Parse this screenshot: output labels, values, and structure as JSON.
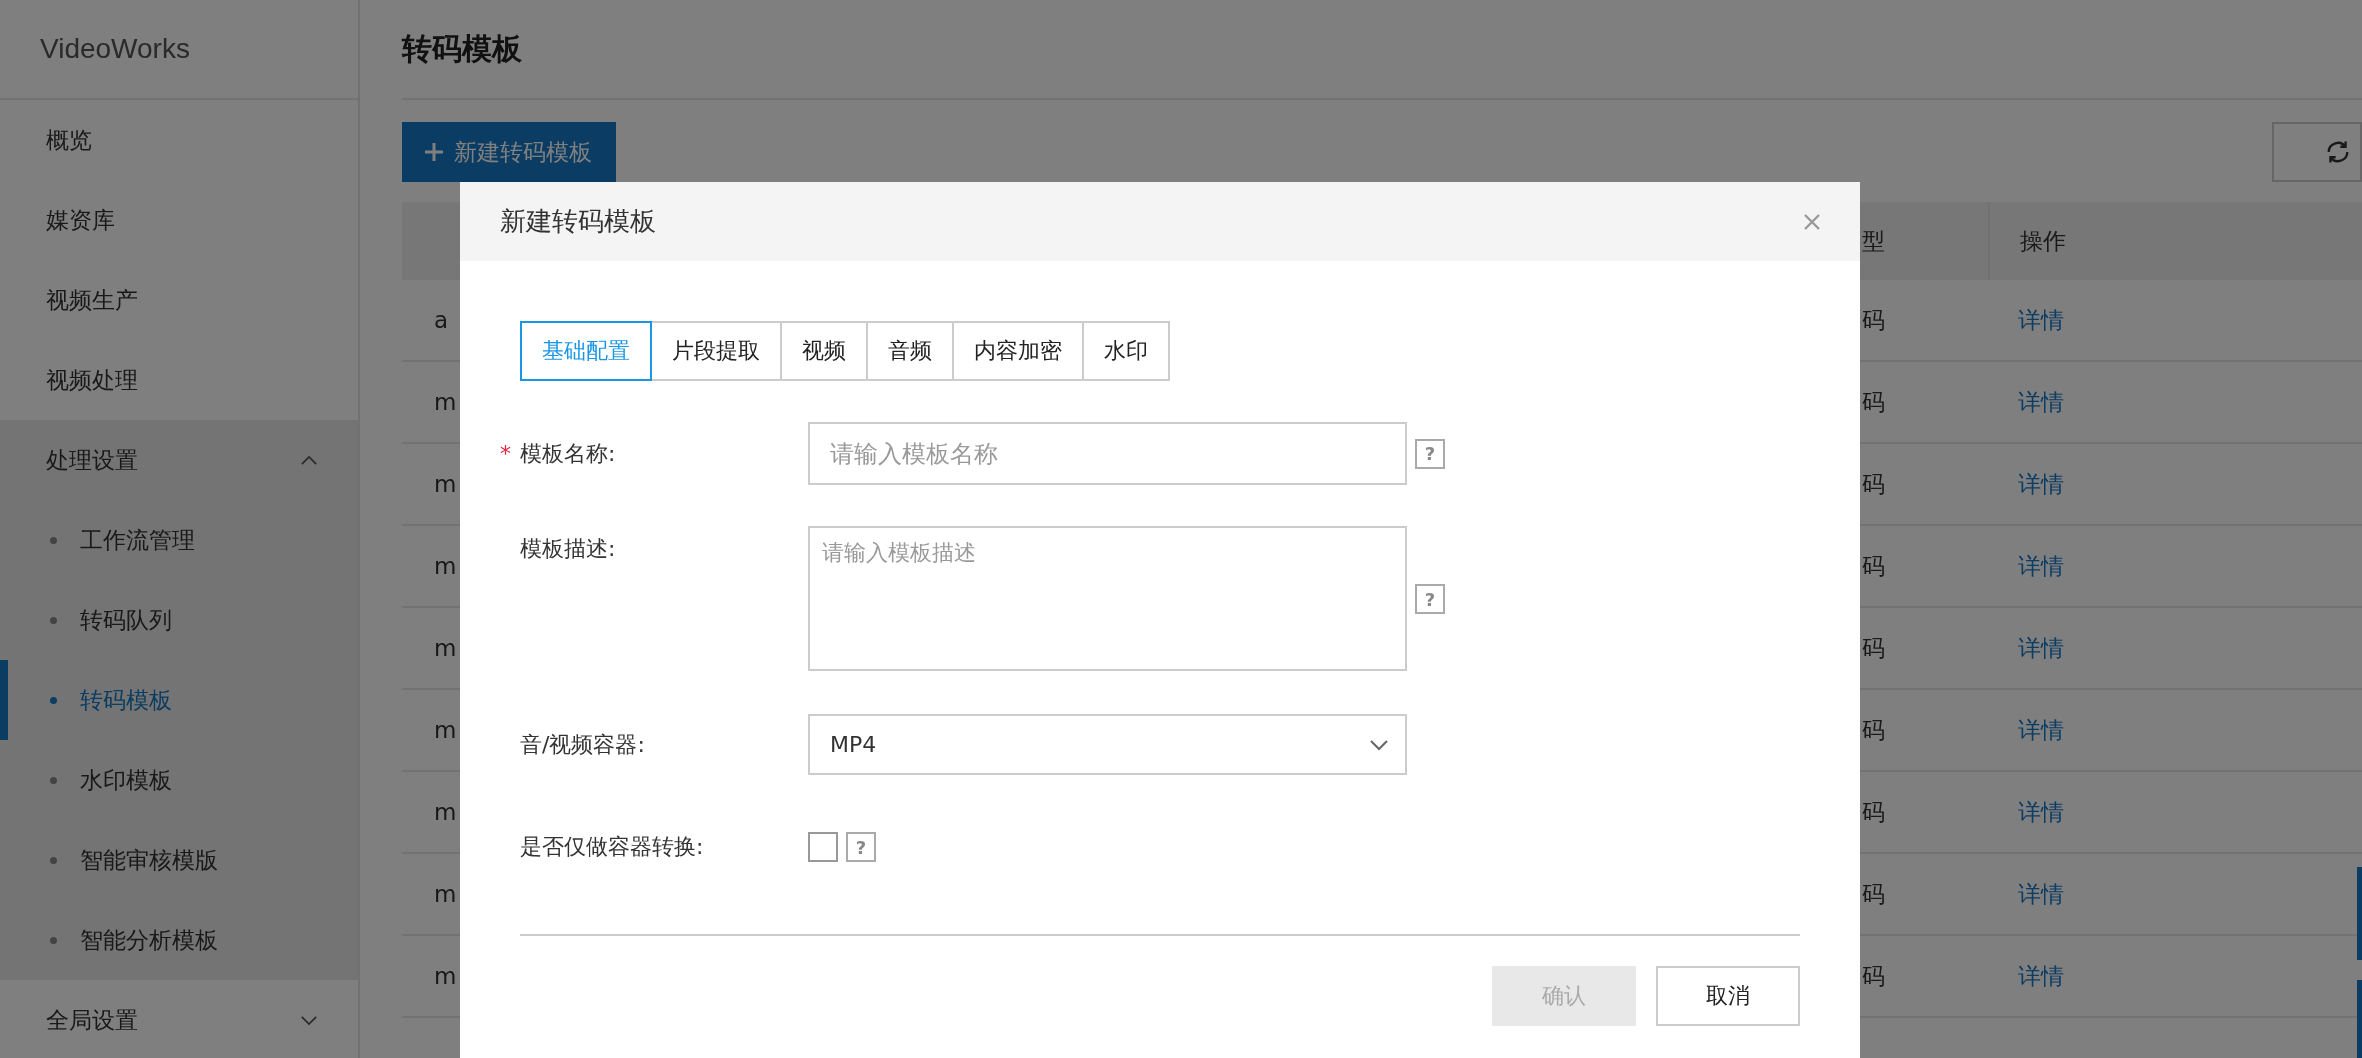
{
  "app": {
    "name": "VideoWorks"
  },
  "sidebar": {
    "items": [
      {
        "label": "概览",
        "kind": "item",
        "selected": false
      },
      {
        "label": "媒资库",
        "kind": "item",
        "selected": false
      },
      {
        "label": "视频生产",
        "kind": "item",
        "selected": false
      },
      {
        "label": "视频处理",
        "kind": "item",
        "selected": false
      },
      {
        "label": "处理设置",
        "kind": "group",
        "expanded": true,
        "children": [
          {
            "label": "工作流管理",
            "selected": false
          },
          {
            "label": "转码队列",
            "selected": false
          },
          {
            "label": "转码模板",
            "selected": true
          },
          {
            "label": "水印模板",
            "selected": false
          },
          {
            "label": "智能审核模版",
            "selected": false
          },
          {
            "label": "智能分析模板",
            "selected": false
          }
        ]
      },
      {
        "label": "全局设置",
        "kind": "group",
        "expanded": false
      }
    ]
  },
  "page": {
    "title": "转码模板",
    "new_button": "新建转码模板"
  },
  "table": {
    "columns": [
      {
        "label": "型"
      },
      {
        "label": "操作"
      }
    ],
    "rows": [
      {
        "column_1": "a",
        "column_2": "码",
        "action": "详情"
      },
      {
        "column_1": "m",
        "column_2": "码",
        "action": "详情"
      },
      {
        "column_1": "m",
        "column_2": "码",
        "action": "详情"
      },
      {
        "column_1": "m",
        "column_2": "码",
        "action": "详情"
      },
      {
        "column_1": "m",
        "column_2": "码",
        "action": "详情"
      },
      {
        "column_1": "m",
        "column_2": "码",
        "action": "详情"
      },
      {
        "column_1": "m",
        "column_2": "码",
        "action": "详情"
      },
      {
        "column_1": "m",
        "column_2": "码",
        "action": "详情"
      },
      {
        "column_1": "m",
        "column_2": "码",
        "action": "详情"
      }
    ]
  },
  "dialog": {
    "title": "新建转码模板",
    "tabs": [
      {
        "label": "基础配置",
        "selected": true
      },
      {
        "label": "片段提取",
        "selected": false
      },
      {
        "label": "视频",
        "selected": false
      },
      {
        "label": "音频",
        "selected": false
      },
      {
        "label": "内容加密",
        "selected": false
      },
      {
        "label": "水印",
        "selected": false
      }
    ],
    "fields": [
      {
        "kind": "text",
        "label": "模板名称:",
        "required_mark": "*",
        "placeholder": "请输入模板名称",
        "help": "?"
      },
      {
        "kind": "textarea",
        "label": "模板描述:",
        "placeholder": "请输入模板描述",
        "help": "?"
      },
      {
        "kind": "select",
        "label": "音/视频容器:",
        "value": "MP4"
      },
      {
        "kind": "checkbox",
        "label": "是否仅做容器转换:",
        "checked": false,
        "help": "?"
      }
    ],
    "buttons": [
      {
        "label": "确认",
        "disabled": true
      },
      {
        "label": "取消",
        "disabled": false
      }
    ]
  }
}
